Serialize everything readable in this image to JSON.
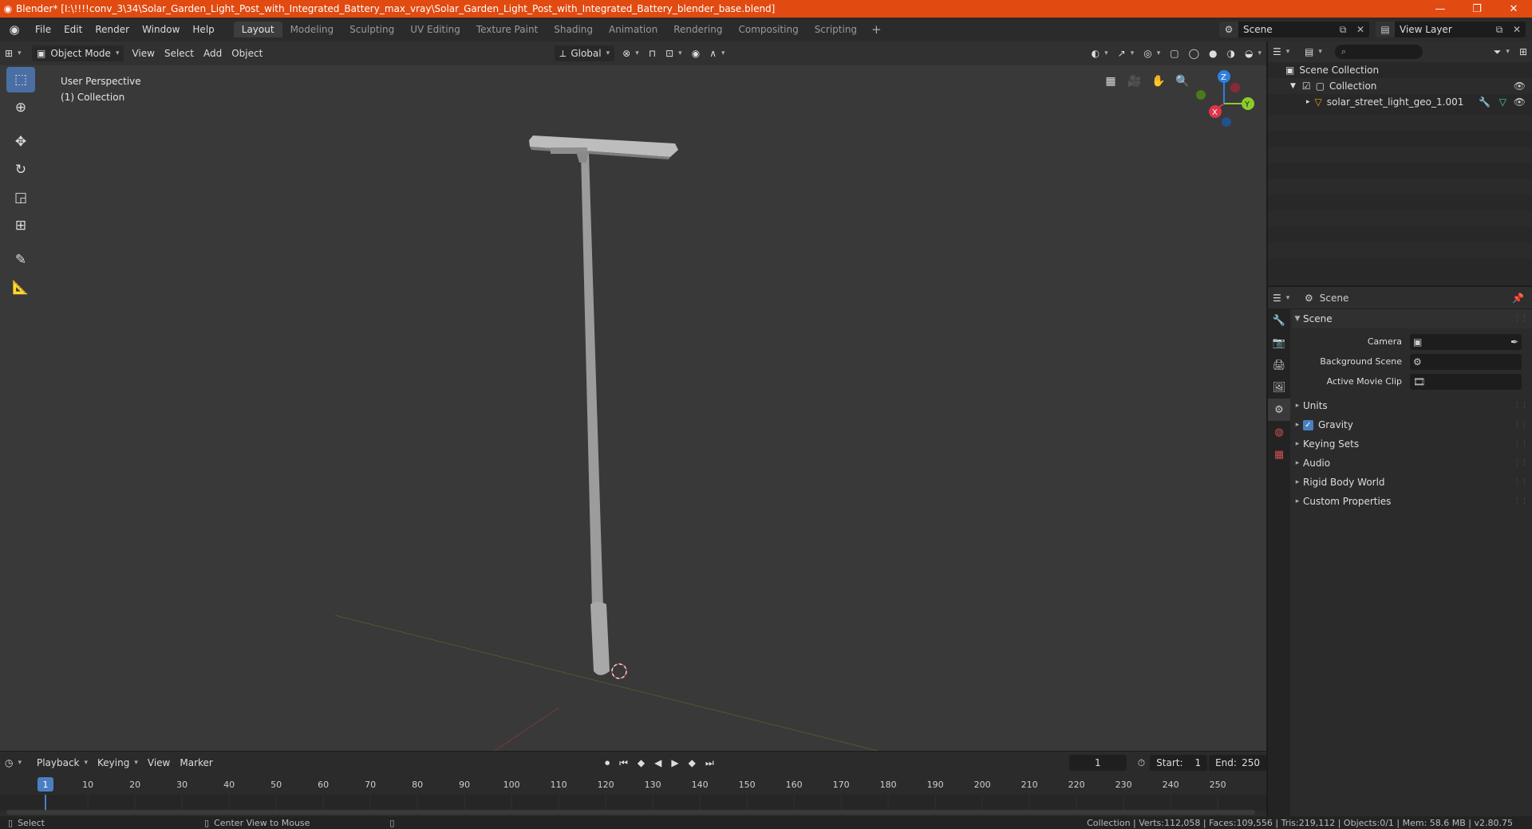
{
  "window": {
    "title": "Blender* [I:\\!!!!conv_3\\34\\Solar_Garden_Light_Post_with_Integrated_Battery_max_vray\\Solar_Garden_Light_Post_with_Integrated_Battery_blender_base.blend]",
    "minimize_icon": "—",
    "restore_icon": "❐",
    "close_icon": "✕"
  },
  "menubar": {
    "items": [
      "File",
      "Edit",
      "Render",
      "Window",
      "Help"
    ],
    "workspaces": [
      "Layout",
      "Modeling",
      "Sculpting",
      "UV Editing",
      "Texture Paint",
      "Shading",
      "Animation",
      "Rendering",
      "Compositing",
      "Scripting"
    ],
    "active_workspace": "Layout",
    "add_tab": "+",
    "scene_label": "Scene",
    "view_layer_label": "View Layer"
  },
  "viewport": {
    "mode": "Object Mode",
    "menus": [
      "View",
      "Select",
      "Add",
      "Object"
    ],
    "orientation": "Global",
    "perspective_label": "User Perspective",
    "collection_label": "(1) Collection",
    "gizmo": {
      "x": "X",
      "y": "Y",
      "z": "Z"
    }
  },
  "outliner": {
    "search_placeholder": "",
    "scene_collection": "Scene Collection",
    "collection": "Collection",
    "object": "solar_street_light_geo_1.001"
  },
  "properties": {
    "context": "Scene",
    "section": "Scene",
    "fields": [
      {
        "label": "Camera",
        "value": ""
      },
      {
        "label": "Background Scene",
        "value": ""
      },
      {
        "label": "Active Movie Clip",
        "value": ""
      }
    ],
    "subsections": [
      "Units",
      "Gravity",
      "Keying Sets",
      "Audio",
      "Rigid Body World",
      "Custom Properties"
    ],
    "gravity_checked": true
  },
  "timeline": {
    "menus": [
      "Playback",
      "Keying",
      "View",
      "Marker"
    ],
    "current_frame": "1",
    "start_label": "Start:",
    "start": "1",
    "end_label": "End:",
    "end": "250",
    "ruler_labels": [
      "1",
      "10",
      "20",
      "30",
      "40",
      "50",
      "60",
      "70",
      "80",
      "90",
      "100",
      "110",
      "120",
      "130",
      "140",
      "150",
      "160",
      "170",
      "180",
      "190",
      "200",
      "210",
      "220",
      "230",
      "240",
      "250"
    ]
  },
  "statusbar": {
    "select": "Select",
    "center_view": "Center View to Mouse",
    "stats": "Collection | Verts:112,058 | Faces:109,556 | Tris:219,112 | Objects:0/1 | Mem: 58.6 MB | v2.80.75"
  },
  "colors": {
    "title_bar": "#e14a10",
    "viewport_bg": "#393939",
    "accent": "#4a7fc1",
    "axis_x": "#e0344a",
    "axis_y": "#8ccc2a",
    "axis_z": "#2f7fe0"
  }
}
